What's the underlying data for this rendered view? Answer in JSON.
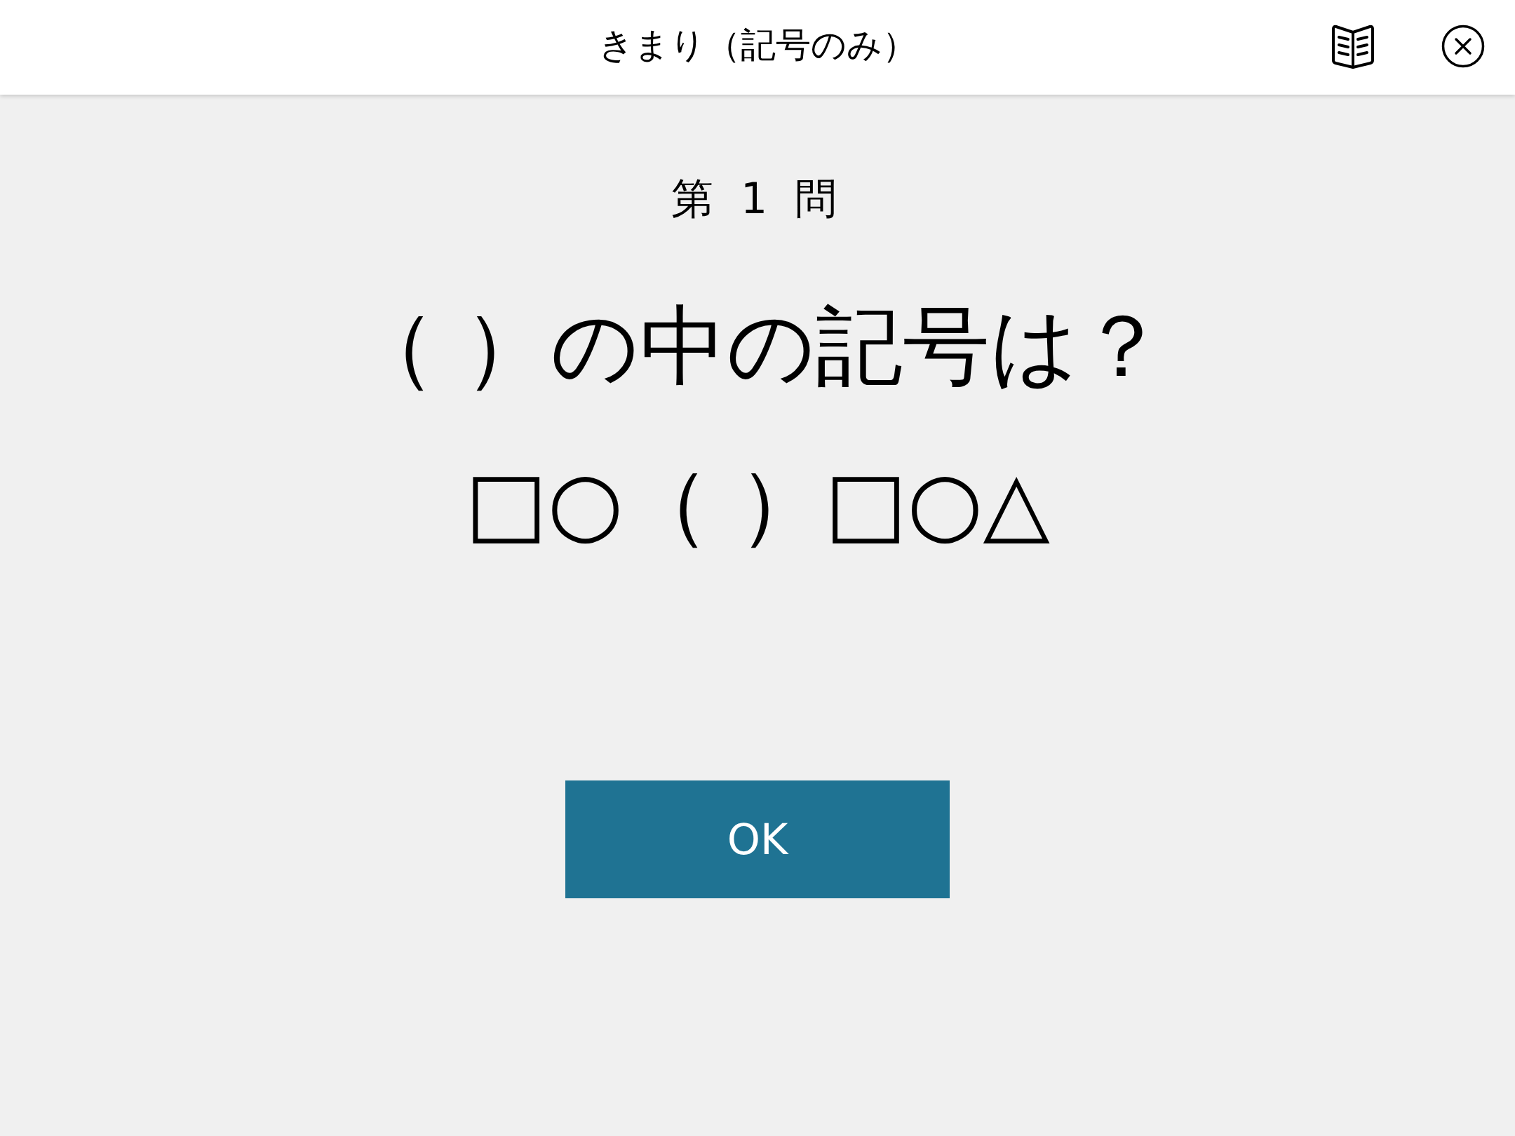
{
  "header": {
    "title": "きまり（記号のみ）"
  },
  "question": {
    "number": "第 1 問",
    "prompt": "（ ）の中の記号は？",
    "sequence": "□○（ ）□○△"
  },
  "ok_button": {
    "label": "OK"
  }
}
